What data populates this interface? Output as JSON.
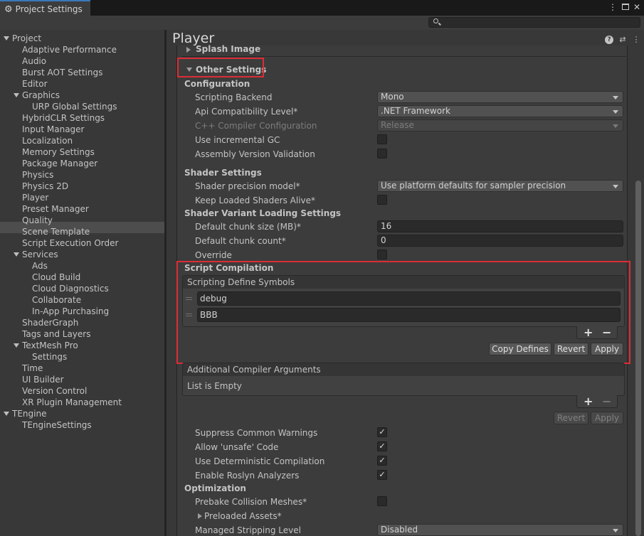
{
  "window": {
    "tab_title": "Project Settings"
  },
  "search": {
    "placeholder": ""
  },
  "sidebar": {
    "items": [
      {
        "label": "Project",
        "indent": 0,
        "foldout": true
      },
      {
        "label": "Adaptive Performance",
        "indent": 1
      },
      {
        "label": "Audio",
        "indent": 1
      },
      {
        "label": "Burst AOT Settings",
        "indent": 1
      },
      {
        "label": "Editor",
        "indent": 1
      },
      {
        "label": "Graphics",
        "indent": 1,
        "foldout": true
      },
      {
        "label": "URP Global Settings",
        "indent": 2
      },
      {
        "label": "HybridCLR Settings",
        "indent": 1
      },
      {
        "label": "Input Manager",
        "indent": 1
      },
      {
        "label": "Localization",
        "indent": 1
      },
      {
        "label": "Memory Settings",
        "indent": 1
      },
      {
        "label": "Package Manager",
        "indent": 1
      },
      {
        "label": "Physics",
        "indent": 1
      },
      {
        "label": "Physics 2D",
        "indent": 1
      },
      {
        "label": "Player",
        "indent": 1,
        "selected": true
      },
      {
        "label": "Preset Manager",
        "indent": 1
      },
      {
        "label": "Quality",
        "indent": 1
      },
      {
        "label": "Scene Template",
        "indent": 1
      },
      {
        "label": "Script Execution Order",
        "indent": 1
      },
      {
        "label": "Services",
        "indent": 1,
        "foldout": true
      },
      {
        "label": "Ads",
        "indent": 2
      },
      {
        "label": "Cloud Build",
        "indent": 2
      },
      {
        "label": "Cloud Diagnostics",
        "indent": 2
      },
      {
        "label": "Collaborate",
        "indent": 2
      },
      {
        "label": "In-App Purchasing",
        "indent": 2
      },
      {
        "label": "ShaderGraph",
        "indent": 1
      },
      {
        "label": "Tags and Layers",
        "indent": 1
      },
      {
        "label": "TextMesh Pro",
        "indent": 1,
        "foldout": true
      },
      {
        "label": "Settings",
        "indent": 2
      },
      {
        "label": "Time",
        "indent": 1
      },
      {
        "label": "UI Builder",
        "indent": 1
      },
      {
        "label": "Version Control",
        "indent": 1
      },
      {
        "label": "XR Plugin Management",
        "indent": 1
      },
      {
        "label": "TEngine",
        "indent": 0,
        "foldout": true
      },
      {
        "label": "TEngineSettings",
        "indent": 1
      }
    ]
  },
  "main": {
    "title": "Player",
    "splash_image": "Splash Image",
    "other_settings": "Other Settings",
    "configuration": {
      "heading": "Configuration",
      "scripting_backend": {
        "label": "Scripting Backend",
        "value": "Mono"
      },
      "api_level": {
        "label": "Api Compatibility Level*",
        "value": ".NET Framework"
      },
      "cpp_config": {
        "label": "C++ Compiler Configuration",
        "value": "Release"
      },
      "incremental_gc": {
        "label": "Use incremental GC",
        "checked": false
      },
      "assembly_validation": {
        "label": "Assembly Version Validation",
        "checked": false
      }
    },
    "shader_settings": {
      "heading": "Shader Settings",
      "precision": {
        "label": "Shader precision model*",
        "value": "Use platform defaults for sampler precision"
      },
      "keep_loaded": {
        "label": "Keep Loaded Shaders Alive*",
        "checked": false
      }
    },
    "shader_variant": {
      "heading": "Shader Variant Loading Settings",
      "chunk_size": {
        "label": "Default chunk size (MB)*",
        "value": "16"
      },
      "chunk_count": {
        "label": "Default chunk count*",
        "value": "0"
      },
      "override": {
        "label": "Override",
        "checked": false
      }
    },
    "script_compilation": {
      "heading": "Script Compilation",
      "define_symbols_header": "Scripting Define Symbols",
      "symbols": [
        "debug",
        "BBB"
      ],
      "copy_defines": "Copy Defines",
      "revert": "Revert",
      "apply": "Apply",
      "compiler_args_header": "Additional Compiler Arguments",
      "compiler_args_empty": "List is Empty",
      "args_revert": "Revert",
      "args_apply": "Apply",
      "plus": "+",
      "minus": "−"
    },
    "compile_options": {
      "suppress_warnings": {
        "label": "Suppress Common Warnings",
        "checked": true
      },
      "allow_unsafe": {
        "label": "Allow 'unsafe' Code",
        "checked": true
      },
      "deterministic": {
        "label": "Use Deterministic Compilation",
        "checked": true
      },
      "roslyn": {
        "label": "Enable Roslyn Analyzers",
        "checked": true
      }
    },
    "optimization": {
      "heading": "Optimization",
      "prebake": {
        "label": "Prebake Collision Meshes*",
        "checked": false
      },
      "preloaded": {
        "label": "Preloaded Assets*"
      },
      "stripping": {
        "label": "Managed Stripping Level",
        "value": "Disabled"
      }
    },
    "check_glyph": "✓"
  },
  "colors": {
    "highlight_box": "#dc2d36",
    "selection": "#4d4d4d",
    "tab_accent": "#3a79bb"
  }
}
